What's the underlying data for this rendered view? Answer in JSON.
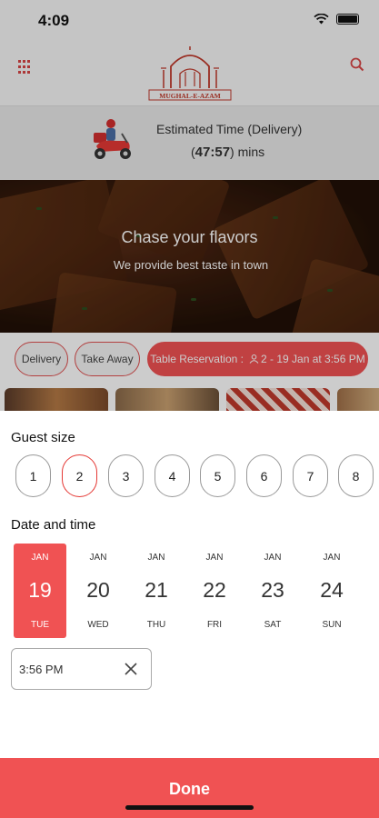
{
  "status_bar": {
    "time": "4:09"
  },
  "header": {
    "logo_text": "MUGHAL-E-AZAM"
  },
  "eta": {
    "label": "Estimated Time (Delivery)",
    "open_paren": "(",
    "value": "47:57",
    "unit": ") mins"
  },
  "hero": {
    "title": "Chase your flavors",
    "subtitle": "We provide best taste in town"
  },
  "order_types": {
    "delivery": "Delivery",
    "takeaway": "Take Away",
    "reservation": "Table Reservation :",
    "reservation_detail": "2 - 19 Jan at 3:56 PM"
  },
  "sheet": {
    "guest_title": "Guest size",
    "guests": [
      "1",
      "2",
      "3",
      "4",
      "5",
      "6",
      "7",
      "8"
    ],
    "selected_guest": "2",
    "date_title": "Date and time",
    "dates": [
      {
        "month": "JAN",
        "day": "19",
        "weekday": "TUE"
      },
      {
        "month": "JAN",
        "day": "20",
        "weekday": "WED"
      },
      {
        "month": "JAN",
        "day": "21",
        "weekday": "THU"
      },
      {
        "month": "JAN",
        "day": "22",
        "weekday": "FRI"
      },
      {
        "month": "JAN",
        "day": "23",
        "weekday": "SAT"
      },
      {
        "month": "JAN",
        "day": "24",
        "weekday": "SUN"
      }
    ],
    "time_value": "3:56 PM",
    "done_label": "Done"
  },
  "colors": {
    "accent": "#f05253",
    "icon_red": "#d84545"
  }
}
